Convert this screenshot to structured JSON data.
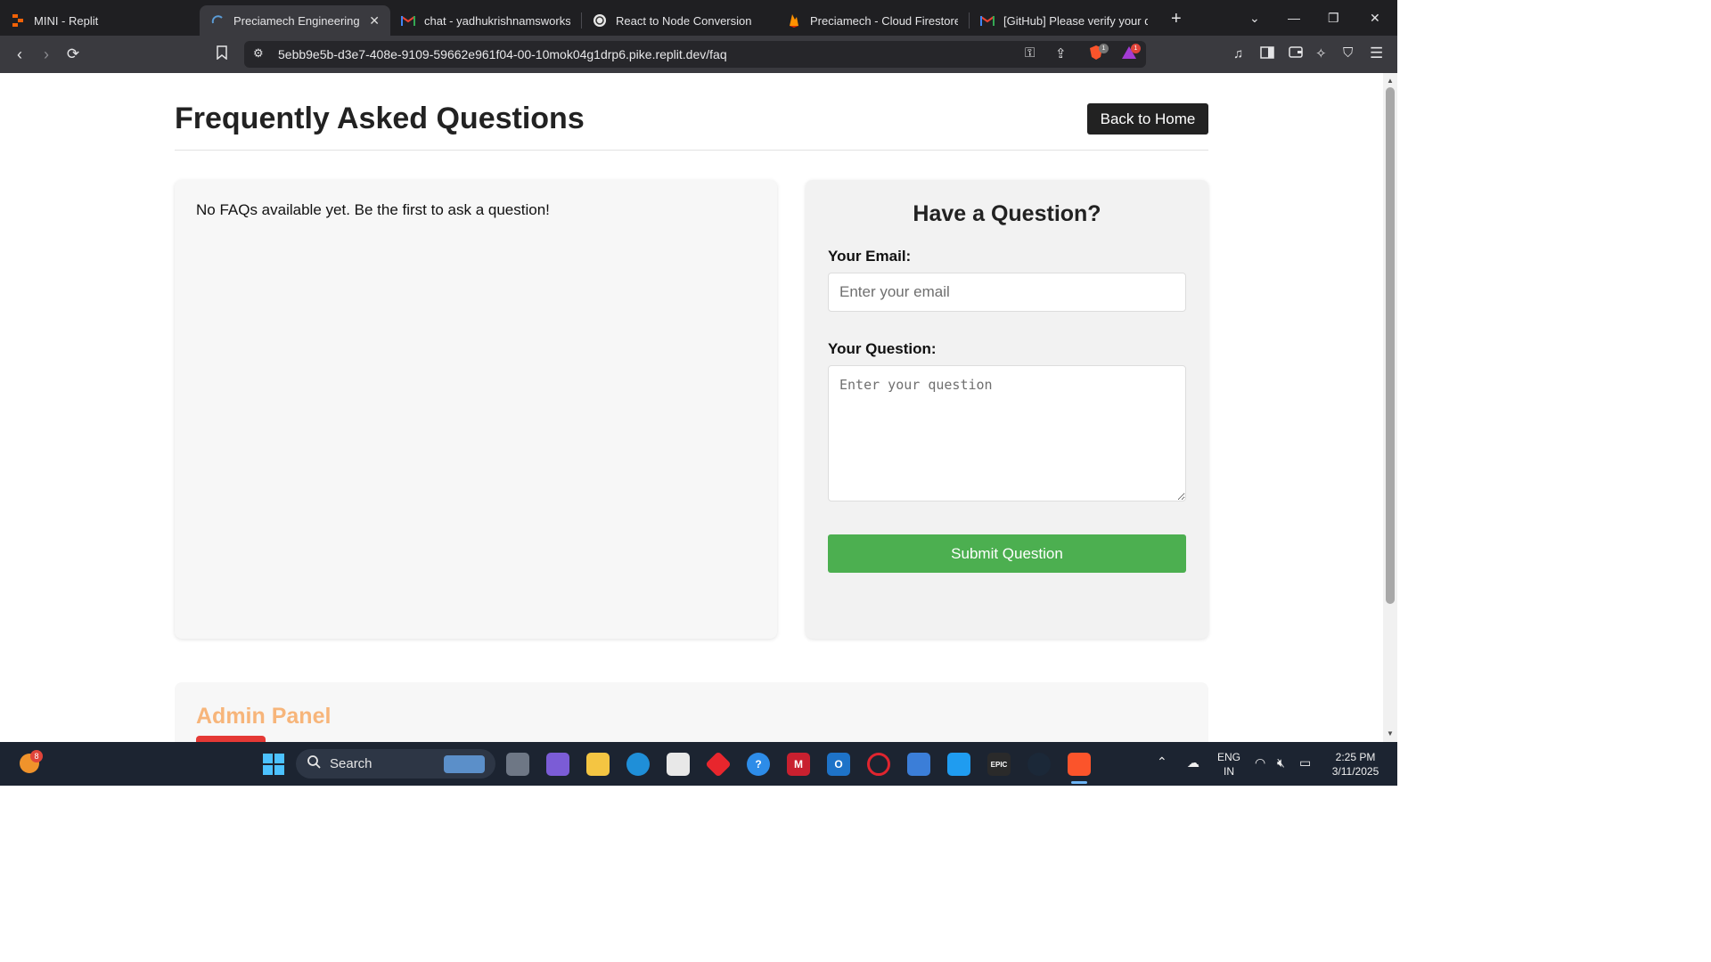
{
  "browser": {
    "tabs": [
      {
        "title": "MINI - Replit",
        "icon": "replit-icon",
        "active": false
      },
      {
        "title": "Preciamech Engineering Co",
        "icon": "loading-spinner-icon",
        "active": true
      },
      {
        "title": "chat - yadhukrishnamsworks@g",
        "icon": "gmail-icon",
        "active": false
      },
      {
        "title": "React to Node Conversion",
        "icon": "chatgpt-icon",
        "active": false
      },
      {
        "title": "Preciamech - Cloud Firestore - F",
        "icon": "firebase-icon",
        "active": false
      },
      {
        "title": "[GitHub] Please verify your devi",
        "icon": "gmail-icon",
        "active": false
      }
    ],
    "url": "5ebb9e5b-d3e7-408e-9109-59662e961f04-00-10mok04g1drp6.pike.replit.dev/faq",
    "brave_shield_count": "1",
    "brave_rewards_count": "1"
  },
  "page": {
    "title": "Frequently Asked Questions",
    "back_button": "Back to Home",
    "faq_empty_message": "No FAQs available yet. Be the first to ask a question!",
    "question_form": {
      "heading": "Have a Question?",
      "email_label": "Your Email:",
      "email_placeholder": "Enter your email",
      "question_label": "Your Question:",
      "question_placeholder": "Enter your question",
      "submit_label": "Submit Question"
    },
    "admin_panel": {
      "heading": "Admin Panel"
    }
  },
  "taskbar": {
    "search_label": "Search",
    "notification_count": "8",
    "language": "ENG",
    "region": "IN",
    "time": "2:25 PM",
    "date": "3/11/2025"
  },
  "colors": {
    "accent_green": "#4caf50",
    "admin_orange": "#f7b57a",
    "admin_red": "#e53935",
    "dark_button": "#222222"
  }
}
